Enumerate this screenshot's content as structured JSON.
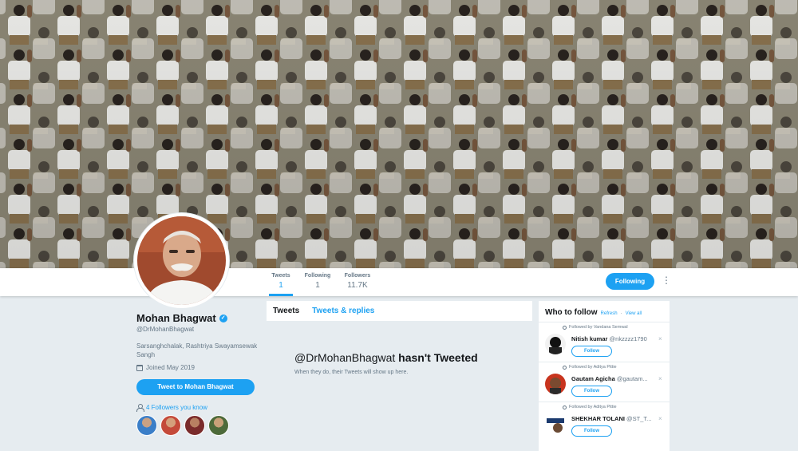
{
  "profile": {
    "name": "Mohan Bhagwat",
    "handle": "@DrMohanBhagwat",
    "bio": "Sarsanghchalak, Rashtriya Swayamsewak Sangh",
    "joined": "Joined May 2019",
    "tweet_to_label": "Tweet to Mohan Bhagwat",
    "followers_you_know": "4 Followers you know"
  },
  "stats": [
    {
      "label": "Tweets",
      "value": "1"
    },
    {
      "label": "Following",
      "value": "1"
    },
    {
      "label": "Followers",
      "value": "11.7K"
    }
  ],
  "actions": {
    "follow_state": "Following",
    "more": "⋮"
  },
  "timeline": {
    "tabs": [
      "Tweets",
      "Tweets & replies"
    ],
    "empty_handle": "@DrMohanBhagwat",
    "empty_suffix": "hasn't Tweeted",
    "empty_sub": "When they do, their Tweets will show up here."
  },
  "who_to_follow": {
    "title": "Who to follow",
    "refresh": "Refresh",
    "separator": "·",
    "view_all": "View all",
    "suggestions": [
      {
        "context": "Followed by Vandana Semwal",
        "name": "Nitish kumar",
        "handle": "@nkzzzz1790",
        "button": "Follow",
        "close": "×"
      },
      {
        "context": "Followed by Aditya Pittie",
        "name": "Gautam Agicha",
        "handle": "@gautam...",
        "button": "Follow",
        "close": "×"
      },
      {
        "context": "Followed by Aditya Pittie",
        "name": "SHEKHAR TOLANI",
        "handle": "@ST_T...",
        "button": "Follow",
        "close": "×"
      }
    ]
  },
  "icons": {
    "verified": "verified-badge-icon",
    "calendar": "calendar-icon",
    "person": "person-icon"
  },
  "colors": {
    "accent": "#1da1f2",
    "background": "#e6ecf0",
    "muted": "#657786"
  }
}
